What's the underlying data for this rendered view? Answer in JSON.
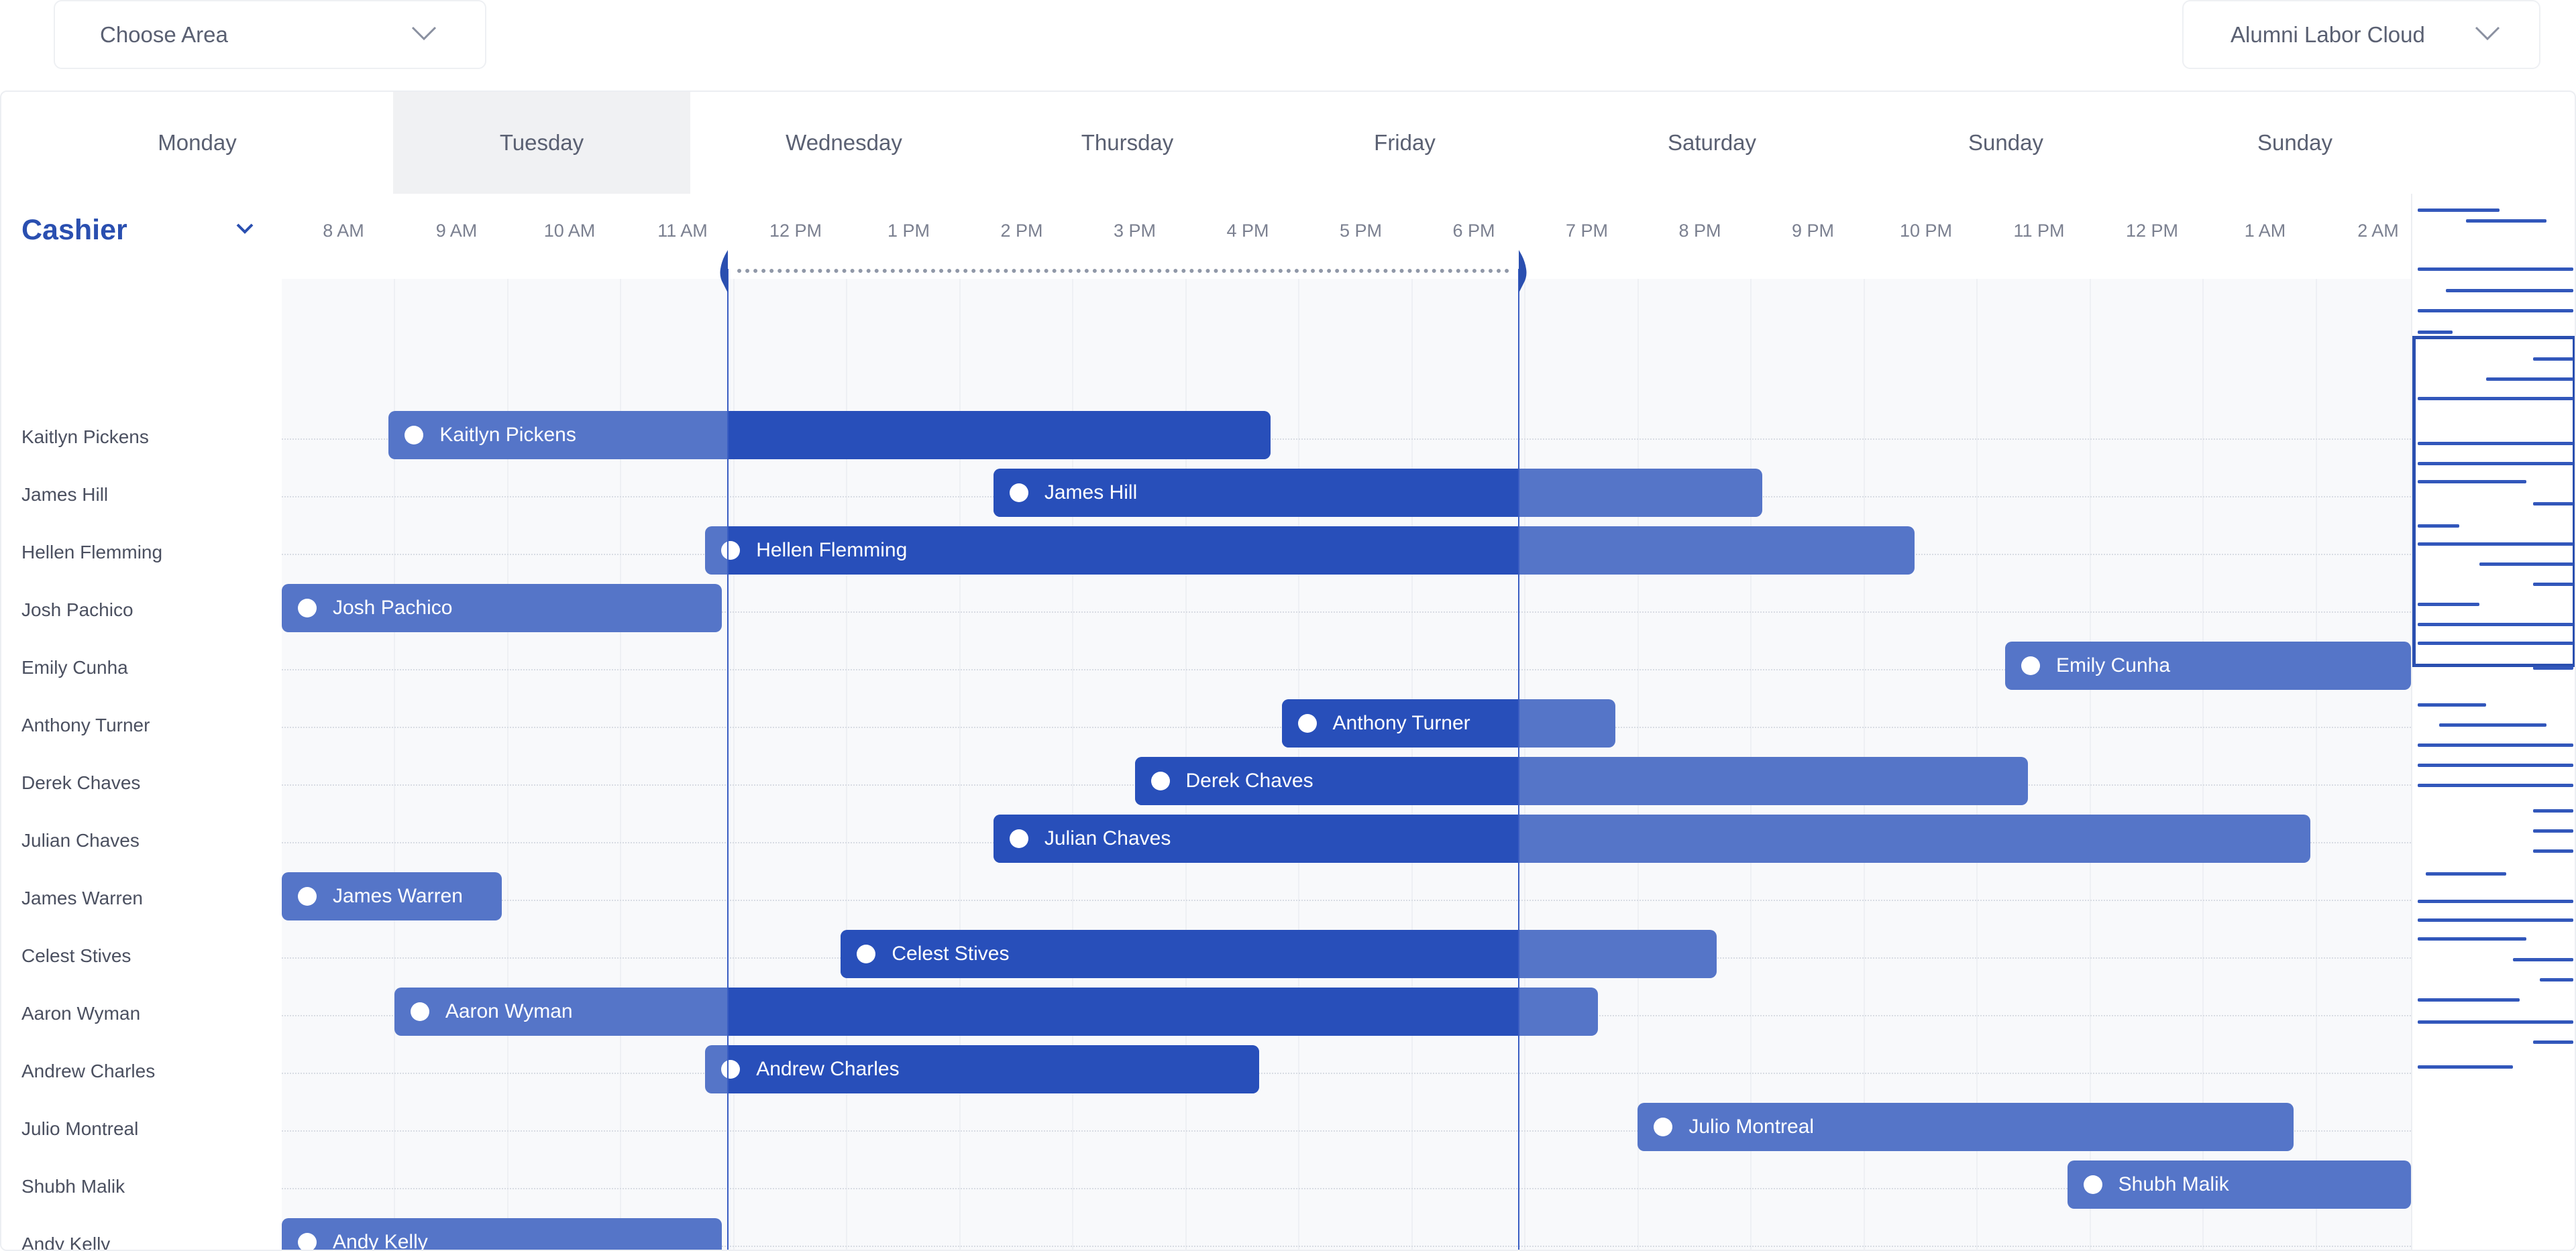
{
  "header": {
    "area_dropdown": {
      "label": "Choose Area"
    },
    "cloud_dropdown": {
      "label": "Alumni Labor Cloud"
    }
  },
  "days": [
    "Monday",
    "Tuesday",
    "Wednesday",
    "Thursday",
    "Friday",
    "Saturday",
    "Sunday",
    "Sunday"
  ],
  "active_day": "Tuesday",
  "role": "Cashier",
  "time_ticks": [
    "8 AM",
    "9 AM",
    "10 AM",
    "11 AM",
    "12 PM",
    "1 PM",
    "2 PM",
    "3 PM",
    "4 PM",
    "5 PM",
    "6 PM",
    "7 PM",
    "8 PM",
    "9 PM",
    "10 PM",
    "11 PM",
    "12 PM",
    "1 AM",
    "2 AM"
  ],
  "selection_range": {
    "start_hour": 11.4,
    "end_hour": 18.4
  },
  "colors": {
    "accent": "#2a4fb0",
    "bar_light": "#5575c8",
    "bar_dark": "#284fba"
  },
  "shifts": [
    {
      "name": "Kaitlyn Pickens",
      "start_hour": 8.4,
      "end_hour": 16.2
    },
    {
      "name": "James Hill",
      "start_hour": 13.75,
      "end_hour": 20.55
    },
    {
      "name": "Hellen Flemming",
      "start_hour": 11.2,
      "end_hour": 21.9
    },
    {
      "name": "Josh Pachico",
      "start_hour": 7.45,
      "end_hour": 11.35
    },
    {
      "name": "Emily Cunha",
      "start_hour": 22.7,
      "end_hour": 27.0
    },
    {
      "name": "Anthony Turner",
      "start_hour": 16.3,
      "end_hour": 19.25
    },
    {
      "name": "Derek Chaves",
      "start_hour": 15.0,
      "end_hour": 22.9
    },
    {
      "name": "Julian Chaves",
      "start_hour": 13.75,
      "end_hour": 25.4
    },
    {
      "name": "James Warren",
      "start_hour": 7.45,
      "end_hour": 9.4
    },
    {
      "name": "Celest Stives",
      "start_hour": 12.4,
      "end_hour": 20.15
    },
    {
      "name": "Aaron Wyman",
      "start_hour": 8.45,
      "end_hour": 19.1
    },
    {
      "name": "Andrew Charles",
      "start_hour": 11.2,
      "end_hour": 16.1
    },
    {
      "name": "Julio Montreal",
      "start_hour": 19.45,
      "end_hour": 25.25
    },
    {
      "name": "Shubh Malik",
      "start_hour": 23.25,
      "end_hour": 27.0
    },
    {
      "name": "Andy Kelly",
      "start_hour": 7.45,
      "end_hour": 11.35
    }
  ]
}
